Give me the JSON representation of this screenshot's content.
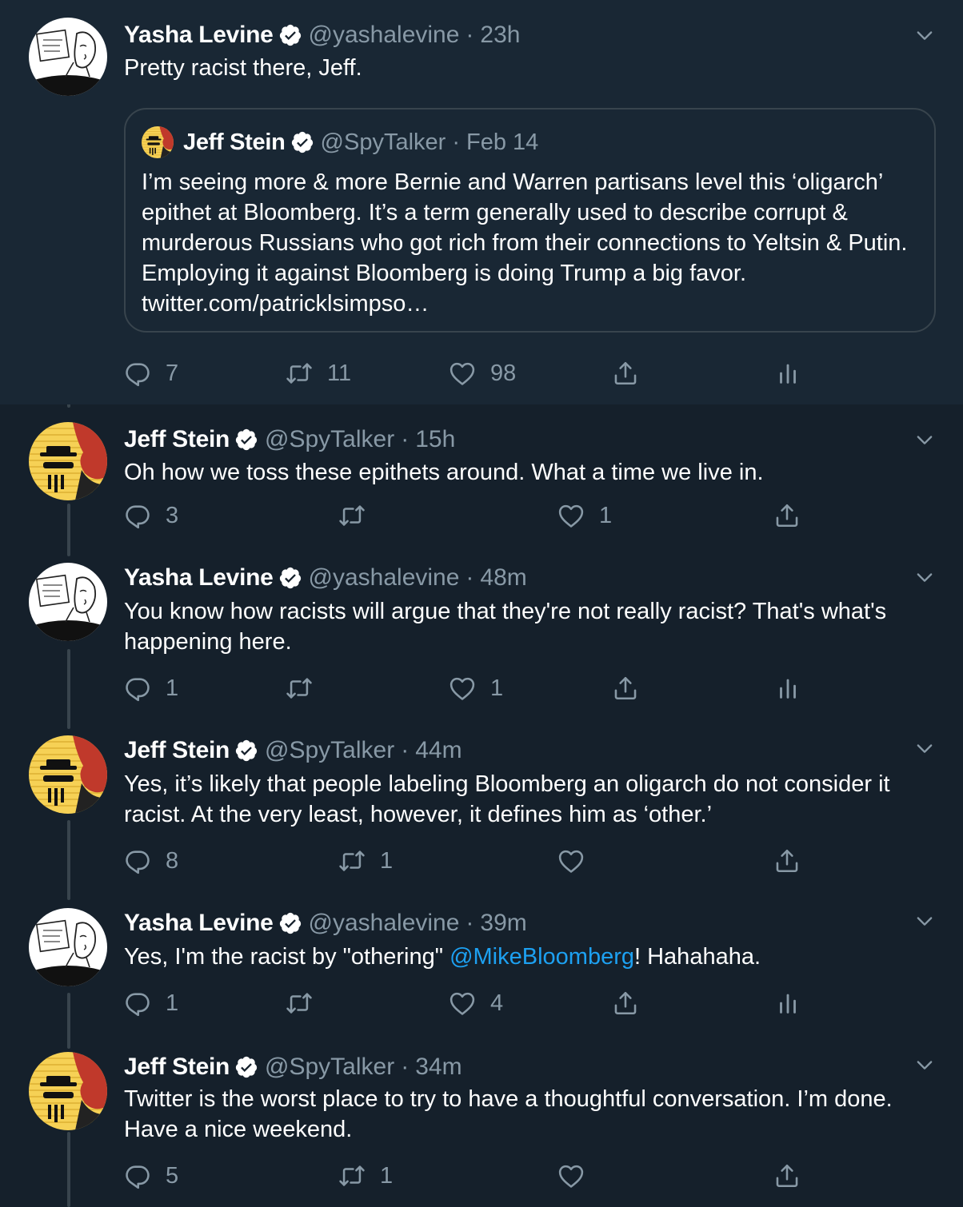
{
  "colors": {
    "background": "#15202b",
    "highlight_background": "#192734",
    "text": "#ffffff",
    "secondary_text": "#8899a6",
    "link": "#1da1f2",
    "border": "#38444d"
  },
  "tweets": [
    {
      "name": "Yasha Levine",
      "handle": "@yashalevine",
      "time": "23h",
      "text": "Pretty racist there, Jeff.",
      "avatar": "sketch-face-avatar",
      "quote": {
        "name": "Jeff Stein",
        "handle": "@SpyTalker",
        "time": "Feb 14",
        "text": "I’m seeing more & more Bernie and Warren partisans level this ‘oligarch’ epithet at Bloomberg. It’s a term generally used to describe corrupt & murderous Russians who got rich from their connections to Yeltsin & Putin. Employing it against Bloomberg is doing Trump a big favor. twitter.com/patricklsimpso…"
      },
      "replies": "7",
      "retweets": "11",
      "likes": "98"
    },
    {
      "name": "Jeff Stein",
      "handle": "@SpyTalker",
      "time": "15h",
      "text": "Oh how we toss these epithets around. What a time we live in.",
      "avatar": "spy-avatar",
      "replies": "3",
      "retweets": "",
      "likes": "1"
    },
    {
      "name": "Yasha Levine",
      "handle": "@yashalevine",
      "time": "48m",
      "text": "You know how racists will argue that they're not really racist? That's what's happening here.",
      "avatar": "sketch-face-avatar",
      "replies": "1",
      "retweets": "",
      "likes": "1"
    },
    {
      "name": "Jeff Stein",
      "handle": "@SpyTalker",
      "time": "44m",
      "text": "Yes, it’s likely that people labeling Bloomberg an oligarch do not consider it racist. At the very least, however, it defines him as ‘other.’",
      "avatar": "spy-avatar",
      "replies": "8",
      "retweets": "1",
      "likes": ""
    },
    {
      "name": "Yasha Levine",
      "handle": "@yashalevine",
      "time": "39m",
      "text_before": "Yes, I'm the racist by \"othering\" ",
      "mention": "@MikeBloomberg",
      "text_after": "! Hahahaha.",
      "avatar": "sketch-face-avatar",
      "replies": "1",
      "retweets": "",
      "likes": "4"
    },
    {
      "name": "Jeff Stein",
      "handle": "@SpyTalker",
      "time": "34m",
      "text": "Twitter is the worst place to try to have a thoughtful conversation. I’m done. Have a nice weekend.",
      "avatar": "spy-avatar",
      "replies": "5",
      "retweets": "1",
      "likes": ""
    }
  ],
  "separator": "·"
}
